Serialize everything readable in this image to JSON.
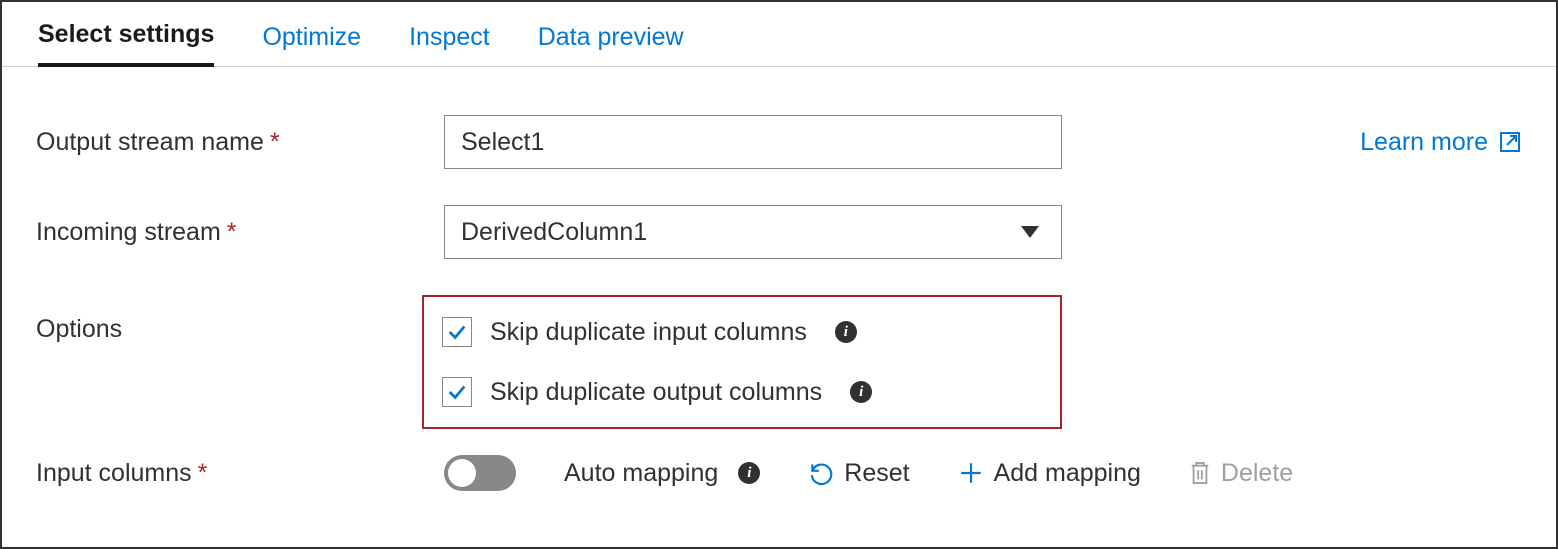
{
  "tabs": {
    "select_settings": "Select settings",
    "optimize": "Optimize",
    "inspect": "Inspect",
    "data_preview": "Data preview"
  },
  "labels": {
    "output_stream_name": "Output stream name",
    "incoming_stream": "Incoming stream",
    "options": "Options",
    "input_columns": "Input columns"
  },
  "fields": {
    "output_stream_name_value": "Select1",
    "incoming_stream_value": "DerivedColumn1"
  },
  "options": {
    "skip_dup_input": "Skip duplicate input columns",
    "skip_dup_output": "Skip duplicate output columns"
  },
  "actions": {
    "auto_mapping": "Auto mapping",
    "reset": "Reset",
    "add_mapping": "Add mapping",
    "delete": "Delete"
  },
  "links": {
    "learn_more": "Learn more"
  },
  "colors": {
    "accent": "#0078d4",
    "danger": "#a4262c"
  }
}
